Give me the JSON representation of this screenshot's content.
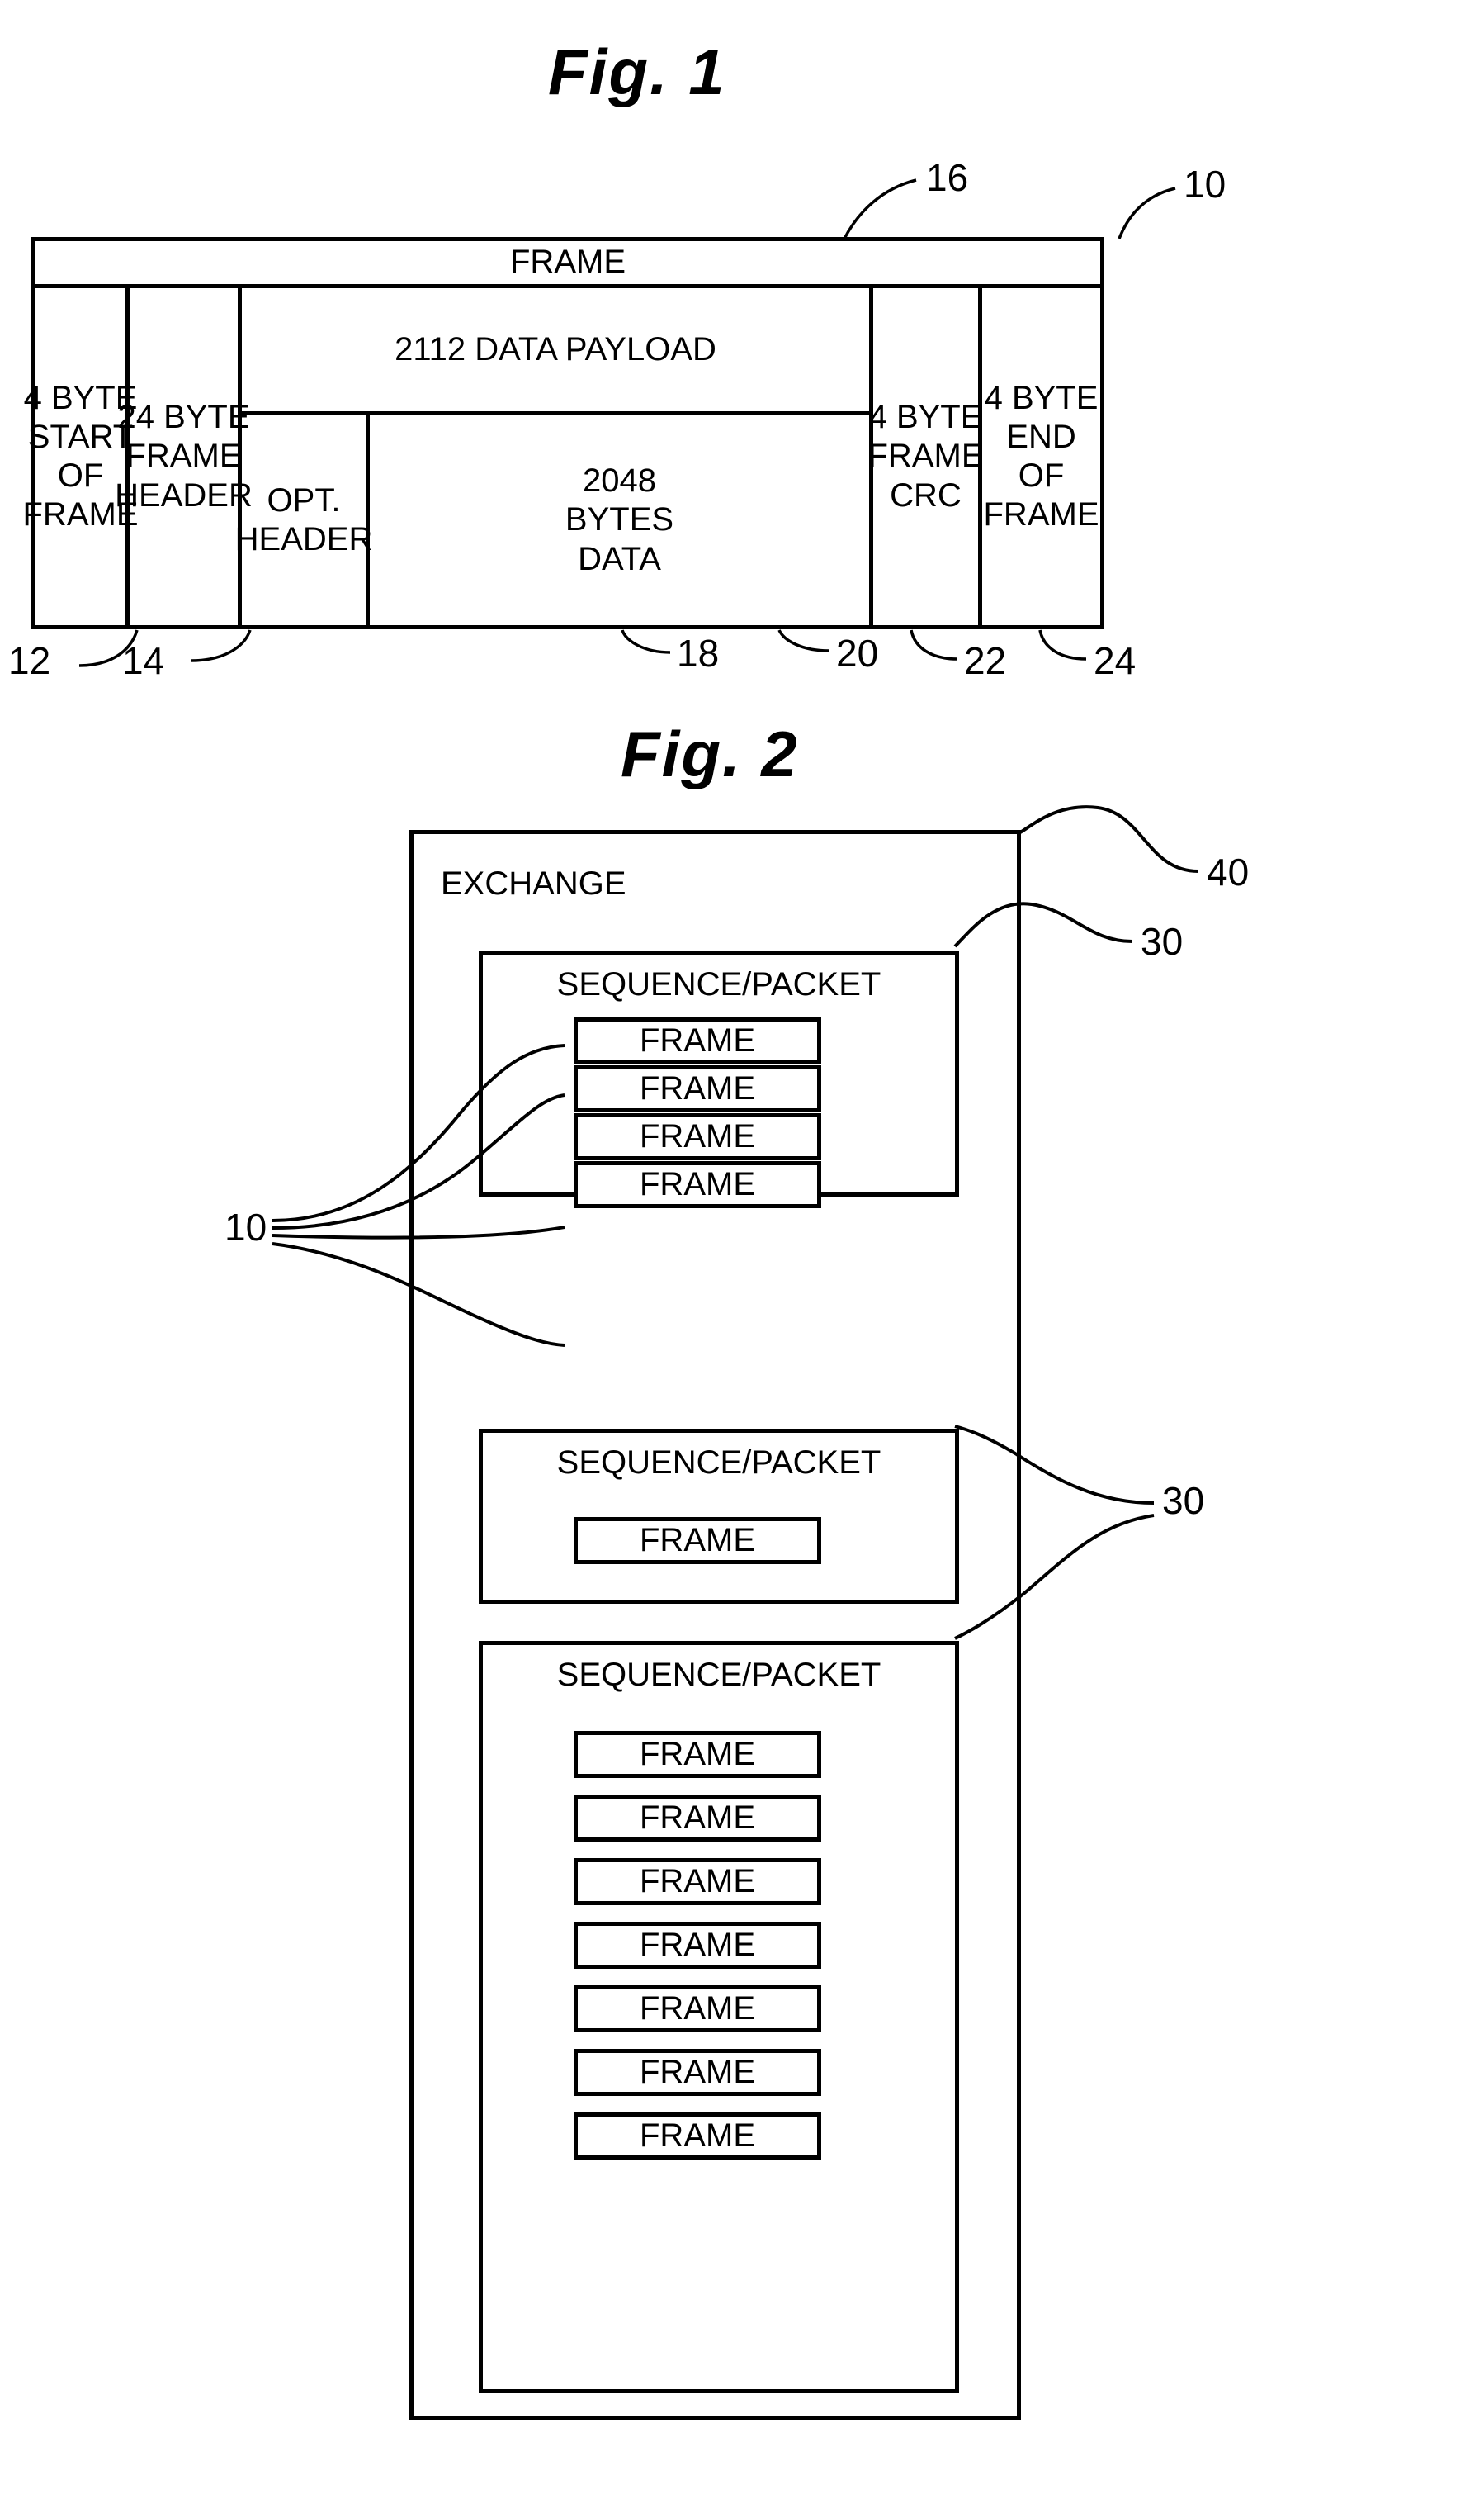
{
  "figures": [
    {
      "title": "Fig. 1",
      "frame_table": {
        "header_label": "FRAME",
        "columns": [
          {
            "label": "4 BYTE\nSTART\nOF\nFRAME",
            "ref": "12"
          },
          {
            "label": "24 BYTE\nFRAME\nHEADER",
            "ref": "14"
          },
          {
            "label": "2112 DATA PAYLOAD",
            "ref": "16"
          },
          {
            "label": "4 BYTE\nFRAME\nCRC",
            "ref": "22"
          },
          {
            "label": "4 BYTE\nEND OF\nFRAME",
            "ref": "24"
          }
        ],
        "payload_title": "2112 DATA PAYLOAD",
        "payload_sub": [
          {
            "label": "OPT.\nHEADER",
            "ref": "18"
          },
          {
            "label": "2048\nBYTES\nDATA",
            "ref": "20"
          }
        ],
        "whole_frame_ref": "10"
      },
      "reference_numerals": [
        "16",
        "10",
        "12",
        "14",
        "18",
        "20",
        "22",
        "24"
      ]
    },
    {
      "title": "Fig. 2",
      "exchange": {
        "label": "EXCHANGE",
        "ref": "40",
        "sequences": [
          {
            "label": "SEQUENCE/PACKET",
            "ref": "30",
            "frames": [
              "FRAME",
              "FRAME",
              "FRAME",
              "FRAME"
            ]
          },
          {
            "label": "SEQUENCE/PACKET",
            "ref": "30",
            "frames": [
              "FRAME"
            ]
          },
          {
            "label": "SEQUENCE/PACKET",
            "ref": "30",
            "frames": [
              "FRAME",
              "FRAME",
              "FRAME",
              "FRAME",
              "FRAME",
              "FRAME",
              "FRAME"
            ]
          }
        ],
        "frame_ref": "10"
      },
      "reference_numerals": [
        "40",
        "30",
        "30",
        "10"
      ]
    }
  ],
  "fig1": {
    "title": "Fig. 1",
    "header": "FRAME",
    "cells": {
      "start_of_frame": "4 BYTE\nSTART\nOF\nFRAME",
      "frame_header": "24 BYTE\nFRAME\nHEADER",
      "payload_title": "2112 DATA PAYLOAD",
      "opt_header": "OPT.\nHEADER",
      "bytes_data": "2048\nBYTES\nDATA",
      "frame_crc": "4 BYTE\nFRAME\nCRC",
      "end_of_frame": "4 BYTE\nEND OF\nFRAME"
    },
    "refs": {
      "payload": "16",
      "frame": "10",
      "start_of_frame": "12",
      "frame_header": "14",
      "opt_header": "18",
      "bytes_data": "20",
      "frame_crc": "22",
      "end_of_frame": "24"
    }
  },
  "fig2": {
    "title": "Fig. 2",
    "exchange_label": "EXCHANGE",
    "seq_label": "SEQUENCE/PACKET",
    "frame_label": "FRAME",
    "refs": {
      "exchange": "40",
      "sequence_top": "30",
      "sequence_mid": "30",
      "frames_group": "10"
    }
  },
  "colors": {
    "ink": "#000000",
    "paper": "#ffffff"
  }
}
